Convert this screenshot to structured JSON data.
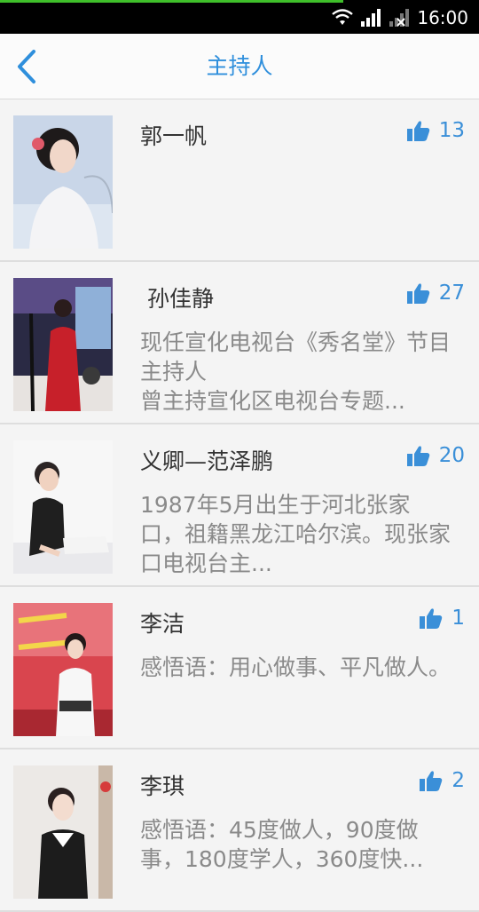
{
  "status_bar": {
    "time": "16:00"
  },
  "header": {
    "title": "主持人"
  },
  "hosts": [
    {
      "name": "郭一帆",
      "likes": "13",
      "desc": ""
    },
    {
      "name": " 孙佳静",
      "likes": "27",
      "desc": "现任宣化电视台《秀名堂》节目主持人\n曾主持宣化区电视台专题..."
    },
    {
      "name": "义卿—范泽鹏",
      "likes": "20",
      "desc": "1987年5月出生于河北张家口，祖籍黑龙江哈尔滨。现张家口电视台主..."
    },
    {
      "name": "李洁",
      "likes": "1",
      "desc": "感悟语：用心做事、平凡做人。"
    },
    {
      "name": "李琪",
      "likes": "2",
      "desc": "感悟语：45度做人，90度做事，180度学人，360度快..."
    }
  ],
  "colors": {
    "accent": "#2f8fdc",
    "like_icon": "#3a8fd8"
  }
}
